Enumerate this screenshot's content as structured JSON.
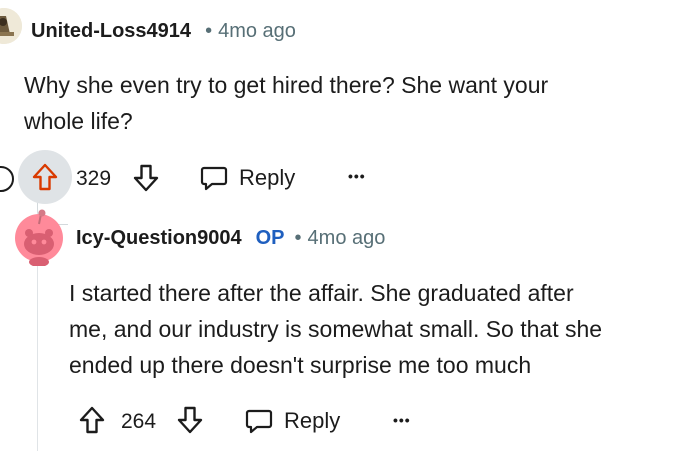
{
  "comment1": {
    "username": "United-Loss4914",
    "time": "4mo ago",
    "body": [
      "Why she even try to get hired there? She want your",
      "whole life?"
    ],
    "votes": "329",
    "reply_label": "Reply",
    "more_label": "•••"
  },
  "comment2": {
    "username": "Icy-Question9004",
    "op_label": "OP",
    "time": "4mo ago",
    "body": [
      "I started there after the affair. She graduated after",
      "me, and our industry is somewhat small. So that she",
      "ended up there doesn't surprise me too much"
    ],
    "votes": "264",
    "reply_label": "Reply",
    "more_label": "•••"
  },
  "colors": {
    "upvote_active": "#d93a00",
    "op_blue": "#1f5fbf",
    "avatar_pink": "#ff8a9a"
  },
  "icons": [
    "collapse-icon",
    "upvote-icon",
    "downvote-icon",
    "reply-bubble-icon",
    "more-options-icon"
  ]
}
